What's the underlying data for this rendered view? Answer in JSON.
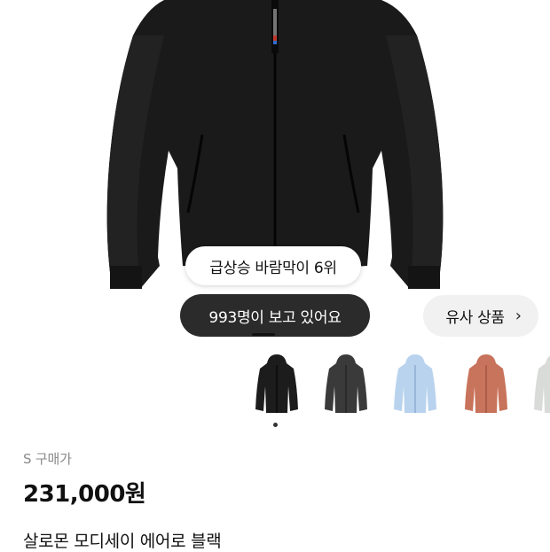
{
  "badges": {
    "rank": "급상승 바람막이 6위",
    "viewers": "993명이 보고 있어요"
  },
  "similar": {
    "label": "유사 상품",
    "icon": "chevron-right-icon"
  },
  "colors": {
    "variants": [
      "#1c1c1c",
      "#3a3a3a",
      "#b9d3ee",
      "#c8735b",
      "#d9dbd8"
    ],
    "dark_pill": "#2b2b2b",
    "similar_bg": "#f1f1f1"
  },
  "product": {
    "size_label": "S 구매가",
    "price": "231,000원",
    "name": "살로몬 모디세이 에어로 블랙"
  }
}
